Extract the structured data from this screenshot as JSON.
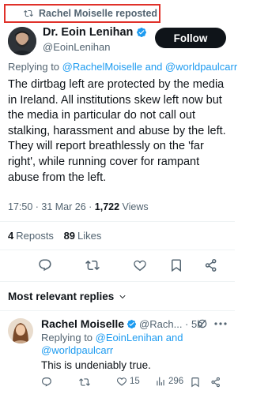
{
  "repost_banner": {
    "label": "Rachel Moiselle reposted"
  },
  "tweet": {
    "author_name": "Dr. Eoin Lenihan",
    "author_handle": "@EoinLenihan",
    "follow_label": "Follow",
    "replying_prefix": "Replying to",
    "replying_targets": "@RachelMoiselle and @worldpaulcarr",
    "body": "The dirtbag left are protected by the media in Ireland. All institutions skew left now but the media in particular do not call out stalking, harassment and abuse by the left. They will report breathlessly on the 'far right', while running cover for rampant abuse from the left.",
    "timestamp": "17:50 · 31 Mar 26 · ",
    "views_count": "1,722",
    "views_label": "Views",
    "reposts_count": "4",
    "reposts_label": "Reposts",
    "likes_count": "89",
    "likes_label": "Likes"
  },
  "replies_header": "Most relevant replies",
  "reply": {
    "author_name": "Rachel Moiselle",
    "handle_time": "@Rach... · 5h",
    "replying_prefix": "Replying to",
    "replying_target_1": "@EoinLenihan and",
    "replying_target_2": "@worldpaulcarr",
    "body": "This is undeniably true.",
    "likes_count": "15",
    "views_count": "296"
  },
  "colors": {
    "accent": "#1d9bf0",
    "highlight_box": "#e0312a",
    "text": "#0f1419",
    "secondary": "#536471"
  }
}
